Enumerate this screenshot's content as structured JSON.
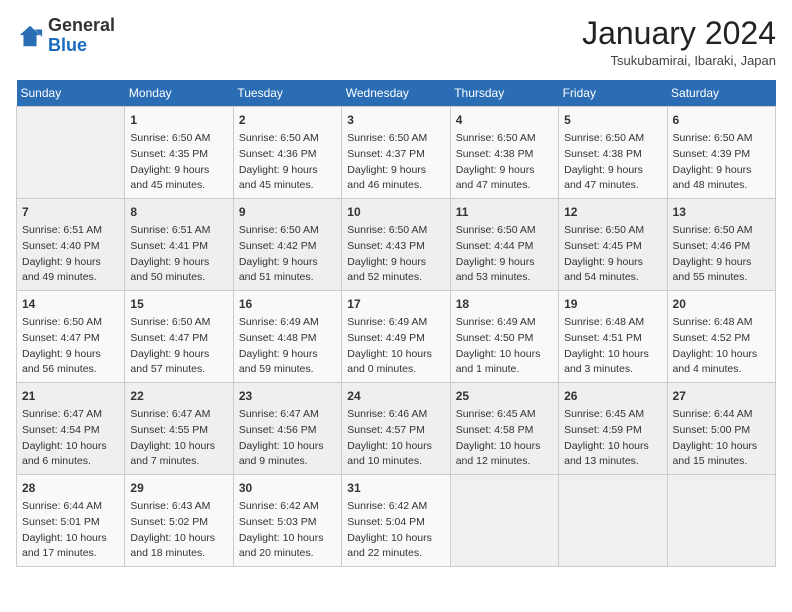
{
  "header": {
    "logo_general": "General",
    "logo_blue": "Blue",
    "month_year": "January 2024",
    "location": "Tsukubamirai, Ibaraki, Japan"
  },
  "days_of_week": [
    "Sunday",
    "Monday",
    "Tuesday",
    "Wednesday",
    "Thursday",
    "Friday",
    "Saturday"
  ],
  "weeks": [
    [
      {
        "day": "",
        "sunrise": "",
        "sunset": "",
        "daylight": ""
      },
      {
        "day": "1",
        "sunrise": "Sunrise: 6:50 AM",
        "sunset": "Sunset: 4:35 PM",
        "daylight": "Daylight: 9 hours and 45 minutes."
      },
      {
        "day": "2",
        "sunrise": "Sunrise: 6:50 AM",
        "sunset": "Sunset: 4:36 PM",
        "daylight": "Daylight: 9 hours and 45 minutes."
      },
      {
        "day": "3",
        "sunrise": "Sunrise: 6:50 AM",
        "sunset": "Sunset: 4:37 PM",
        "daylight": "Daylight: 9 hours and 46 minutes."
      },
      {
        "day": "4",
        "sunrise": "Sunrise: 6:50 AM",
        "sunset": "Sunset: 4:38 PM",
        "daylight": "Daylight: 9 hours and 47 minutes."
      },
      {
        "day": "5",
        "sunrise": "Sunrise: 6:50 AM",
        "sunset": "Sunset: 4:38 PM",
        "daylight": "Daylight: 9 hours and 47 minutes."
      },
      {
        "day": "6",
        "sunrise": "Sunrise: 6:50 AM",
        "sunset": "Sunset: 4:39 PM",
        "daylight": "Daylight: 9 hours and 48 minutes."
      }
    ],
    [
      {
        "day": "7",
        "sunrise": "Sunrise: 6:51 AM",
        "sunset": "Sunset: 4:40 PM",
        "daylight": "Daylight: 9 hours and 49 minutes."
      },
      {
        "day": "8",
        "sunrise": "Sunrise: 6:51 AM",
        "sunset": "Sunset: 4:41 PM",
        "daylight": "Daylight: 9 hours and 50 minutes."
      },
      {
        "day": "9",
        "sunrise": "Sunrise: 6:50 AM",
        "sunset": "Sunset: 4:42 PM",
        "daylight": "Daylight: 9 hours and 51 minutes."
      },
      {
        "day": "10",
        "sunrise": "Sunrise: 6:50 AM",
        "sunset": "Sunset: 4:43 PM",
        "daylight": "Daylight: 9 hours and 52 minutes."
      },
      {
        "day": "11",
        "sunrise": "Sunrise: 6:50 AM",
        "sunset": "Sunset: 4:44 PM",
        "daylight": "Daylight: 9 hours and 53 minutes."
      },
      {
        "day": "12",
        "sunrise": "Sunrise: 6:50 AM",
        "sunset": "Sunset: 4:45 PM",
        "daylight": "Daylight: 9 hours and 54 minutes."
      },
      {
        "day": "13",
        "sunrise": "Sunrise: 6:50 AM",
        "sunset": "Sunset: 4:46 PM",
        "daylight": "Daylight: 9 hours and 55 minutes."
      }
    ],
    [
      {
        "day": "14",
        "sunrise": "Sunrise: 6:50 AM",
        "sunset": "Sunset: 4:47 PM",
        "daylight": "Daylight: 9 hours and 56 minutes."
      },
      {
        "day": "15",
        "sunrise": "Sunrise: 6:50 AM",
        "sunset": "Sunset: 4:47 PM",
        "daylight": "Daylight: 9 hours and 57 minutes."
      },
      {
        "day": "16",
        "sunrise": "Sunrise: 6:49 AM",
        "sunset": "Sunset: 4:48 PM",
        "daylight": "Daylight: 9 hours and 59 minutes."
      },
      {
        "day": "17",
        "sunrise": "Sunrise: 6:49 AM",
        "sunset": "Sunset: 4:49 PM",
        "daylight": "Daylight: 10 hours and 0 minutes."
      },
      {
        "day": "18",
        "sunrise": "Sunrise: 6:49 AM",
        "sunset": "Sunset: 4:50 PM",
        "daylight": "Daylight: 10 hours and 1 minute."
      },
      {
        "day": "19",
        "sunrise": "Sunrise: 6:48 AM",
        "sunset": "Sunset: 4:51 PM",
        "daylight": "Daylight: 10 hours and 3 minutes."
      },
      {
        "day": "20",
        "sunrise": "Sunrise: 6:48 AM",
        "sunset": "Sunset: 4:52 PM",
        "daylight": "Daylight: 10 hours and 4 minutes."
      }
    ],
    [
      {
        "day": "21",
        "sunrise": "Sunrise: 6:47 AM",
        "sunset": "Sunset: 4:54 PM",
        "daylight": "Daylight: 10 hours and 6 minutes."
      },
      {
        "day": "22",
        "sunrise": "Sunrise: 6:47 AM",
        "sunset": "Sunset: 4:55 PM",
        "daylight": "Daylight: 10 hours and 7 minutes."
      },
      {
        "day": "23",
        "sunrise": "Sunrise: 6:47 AM",
        "sunset": "Sunset: 4:56 PM",
        "daylight": "Daylight: 10 hours and 9 minutes."
      },
      {
        "day": "24",
        "sunrise": "Sunrise: 6:46 AM",
        "sunset": "Sunset: 4:57 PM",
        "daylight": "Daylight: 10 hours and 10 minutes."
      },
      {
        "day": "25",
        "sunrise": "Sunrise: 6:45 AM",
        "sunset": "Sunset: 4:58 PM",
        "daylight": "Daylight: 10 hours and 12 minutes."
      },
      {
        "day": "26",
        "sunrise": "Sunrise: 6:45 AM",
        "sunset": "Sunset: 4:59 PM",
        "daylight": "Daylight: 10 hours and 13 minutes."
      },
      {
        "day": "27",
        "sunrise": "Sunrise: 6:44 AM",
        "sunset": "Sunset: 5:00 PM",
        "daylight": "Daylight: 10 hours and 15 minutes."
      }
    ],
    [
      {
        "day": "28",
        "sunrise": "Sunrise: 6:44 AM",
        "sunset": "Sunset: 5:01 PM",
        "daylight": "Daylight: 10 hours and 17 minutes."
      },
      {
        "day": "29",
        "sunrise": "Sunrise: 6:43 AM",
        "sunset": "Sunset: 5:02 PM",
        "daylight": "Daylight: 10 hours and 18 minutes."
      },
      {
        "day": "30",
        "sunrise": "Sunrise: 6:42 AM",
        "sunset": "Sunset: 5:03 PM",
        "daylight": "Daylight: 10 hours and 20 minutes."
      },
      {
        "day": "31",
        "sunrise": "Sunrise: 6:42 AM",
        "sunset": "Sunset: 5:04 PM",
        "daylight": "Daylight: 10 hours and 22 minutes."
      },
      {
        "day": "",
        "sunrise": "",
        "sunset": "",
        "daylight": ""
      },
      {
        "day": "",
        "sunrise": "",
        "sunset": "",
        "daylight": ""
      },
      {
        "day": "",
        "sunrise": "",
        "sunset": "",
        "daylight": ""
      }
    ]
  ]
}
